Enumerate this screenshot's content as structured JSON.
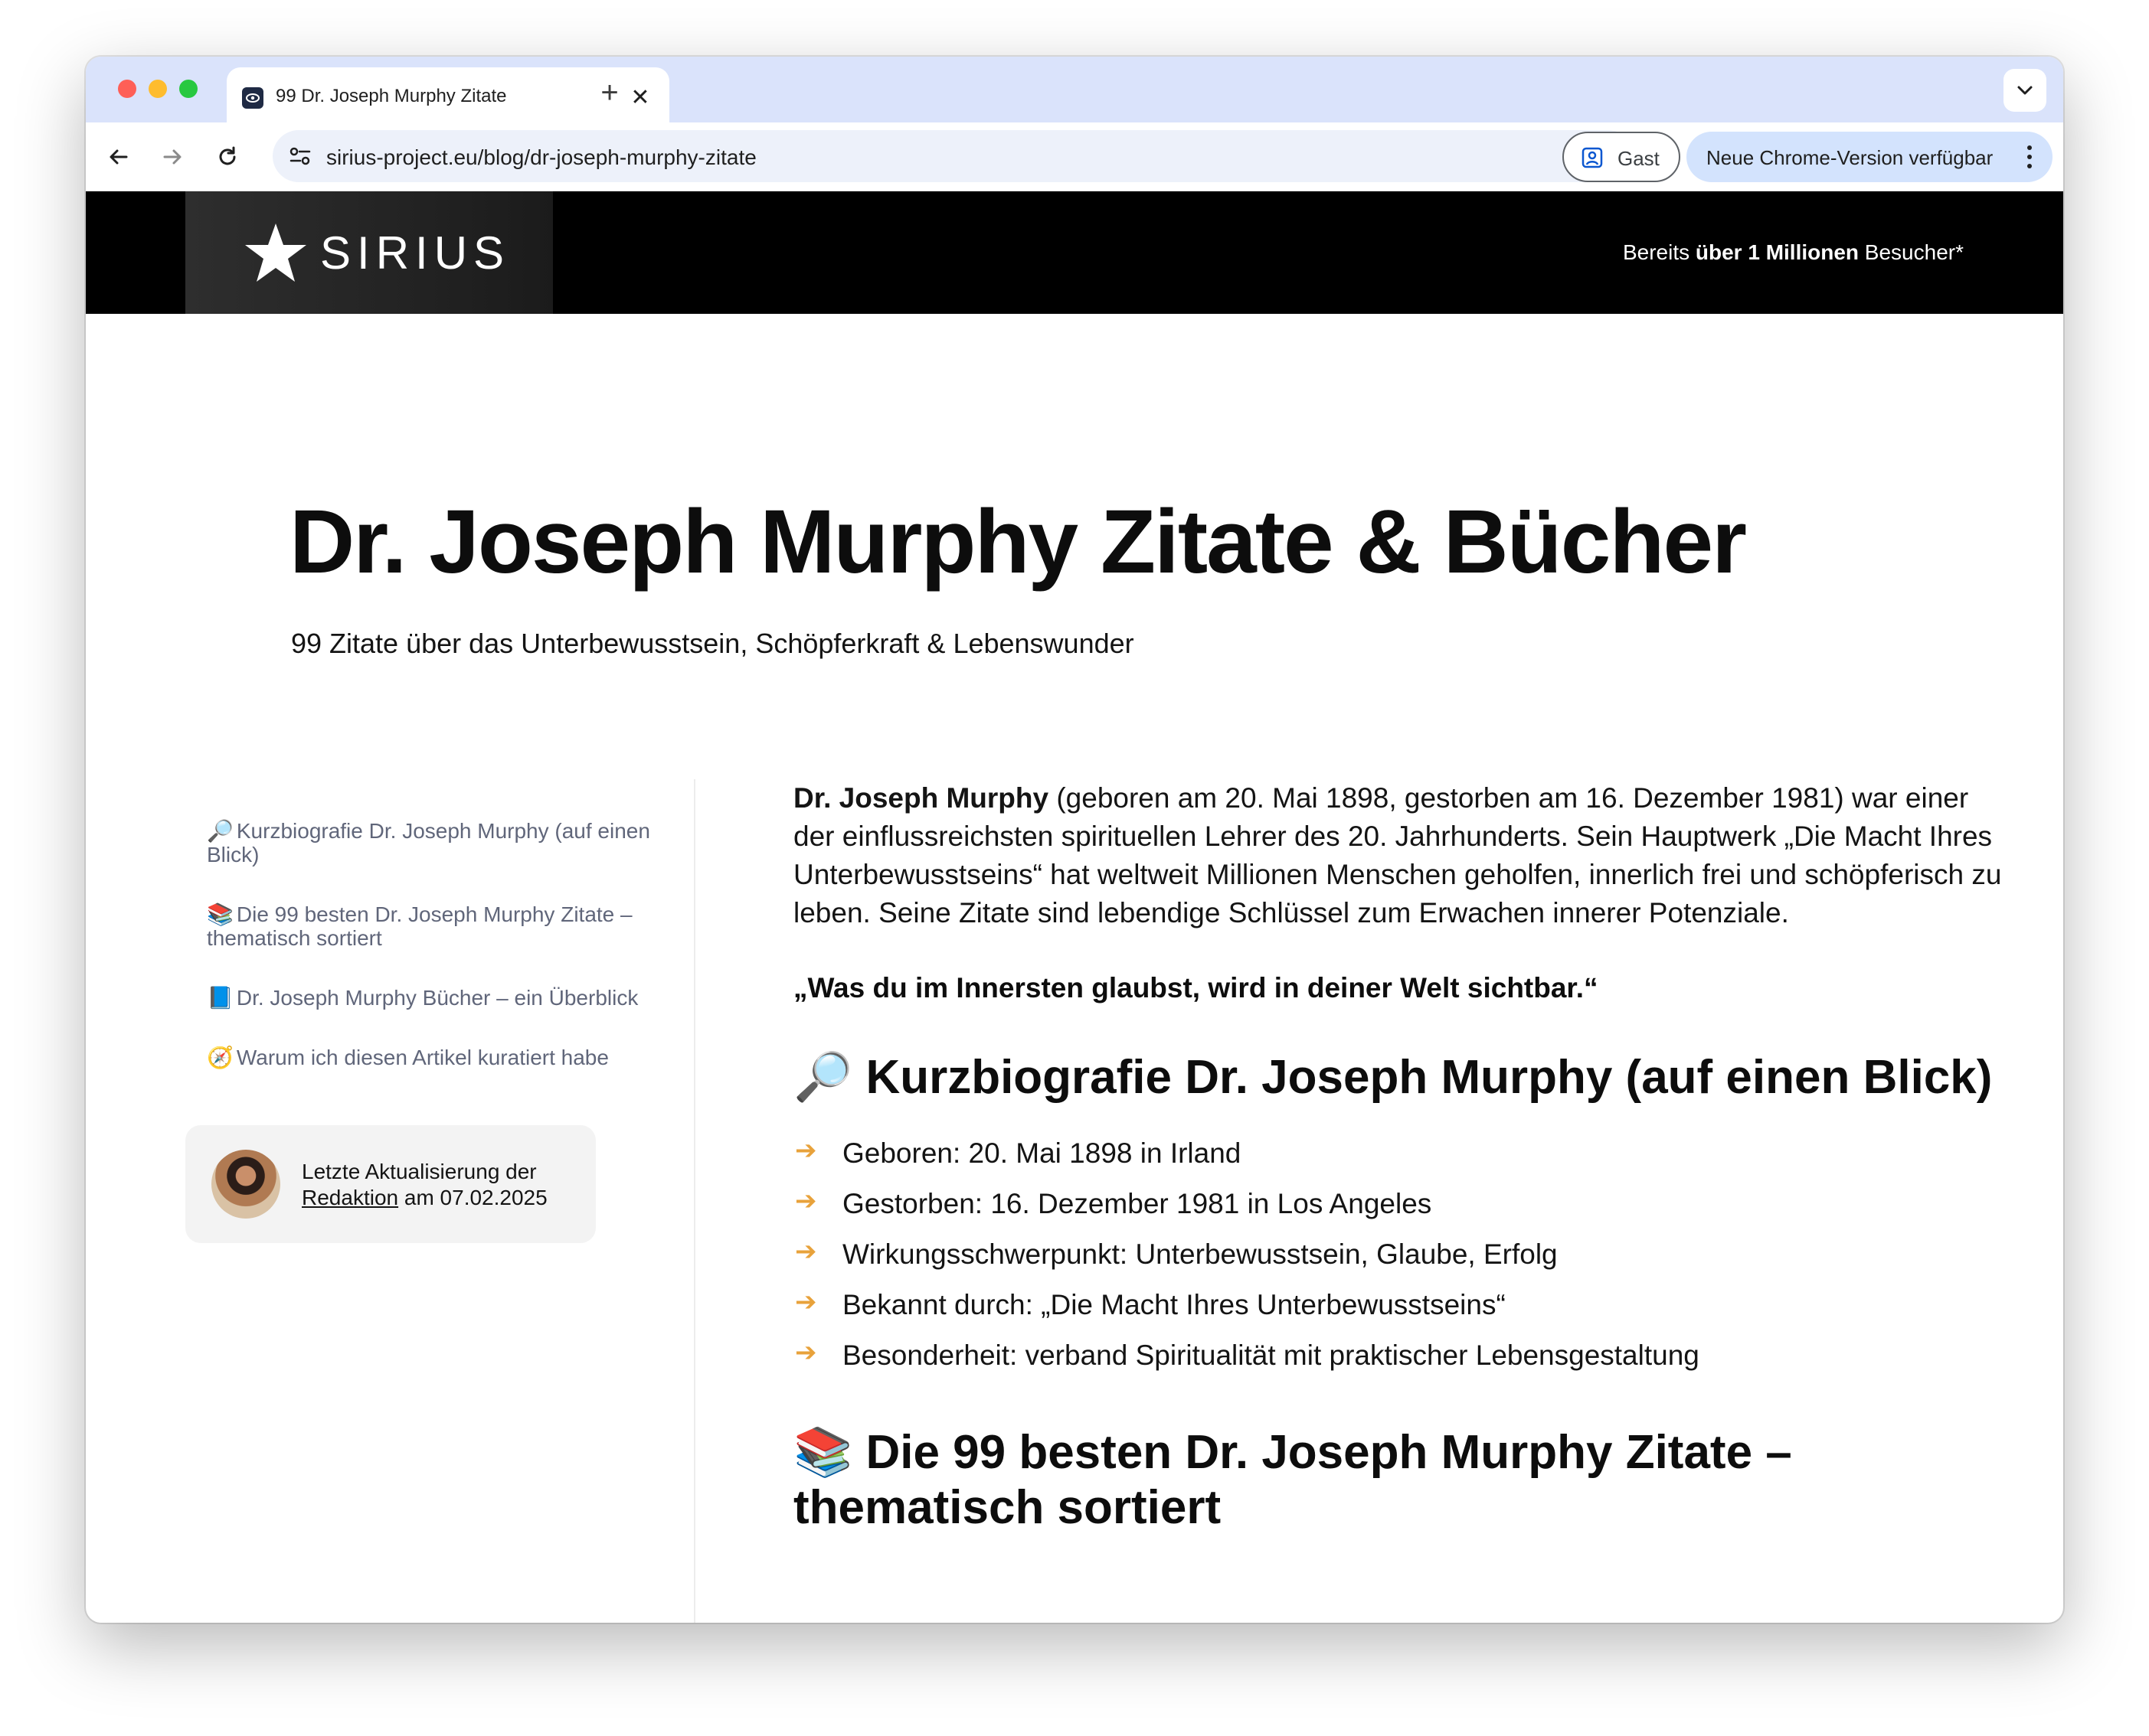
{
  "browser": {
    "tab_title": "99 Dr. Joseph Murphy Zitate",
    "url": "sirius-project.eu/blog/dr-joseph-murphy-zitate",
    "guest_label": "Gast",
    "update_label": "Neue Chrome-Version verfügbar"
  },
  "site": {
    "logo_text": "SIRIUS",
    "visitors_prefix": "Bereits ",
    "visitors_bold": "über 1 Millionen",
    "visitors_suffix": " Besucher*"
  },
  "header": {
    "title": "Dr. Joseph Murphy Zitate & Bücher",
    "subtitle": "99 Zitate über das Unterbewusstsein, Schöpferkraft & Lebenswunder"
  },
  "sidebar": {
    "toc": [
      {
        "emoji": "🔎",
        "label": "Kurzbiografie Dr. Joseph Murphy (auf einen Blick)"
      },
      {
        "emoji": "📚",
        "label": "Die 99 besten Dr. Joseph Murphy Zitate – thematisch sortiert"
      },
      {
        "emoji": "📘",
        "label": "Dr. Joseph Murphy Bücher – ein Überblick"
      },
      {
        "emoji": "🧭",
        "label": "Warum ich diesen Artikel kuratiert habe"
      }
    ],
    "update_card": {
      "line1": "Letzte Aktualisierung der",
      "link": "Redaktion",
      "date_text": " am 07.02.2025"
    }
  },
  "article": {
    "intro_bold": "Dr. Joseph Murphy",
    "intro_rest": " (geboren am 20. Mai 1898, gestorben am 16. Dezember 1981) war einer der einflussreichsten spirituellen Lehrer des 20. Jahrhunderts. Sein Hauptwerk „Die Macht Ihres Unterbewusstseins“ hat weltweit Millionen Menschen geholfen, innerlich frei und schöpferisch zu leben. Seine Zitate sind lebendige Schlüssel zum Erwachen innerer Potenziale.",
    "quote": "„Was du im Innersten glaubst, wird in deiner Welt sichtbar.“",
    "section1_emoji": "🔎",
    "section1_title": "Kurzbiografie Dr. Joseph Murphy (auf einen Blick)",
    "facts": [
      "Geboren: 20. Mai 1898 in Irland",
      "Gestorben: 16. Dezember 1981 in Los Angeles",
      "Wirkungsschwerpunkt: Unterbewusstsein, Glaube, Erfolg",
      "Bekannt durch: „Die Macht Ihres Unterbewusstseins“",
      "Besonderheit: verband Spiritualität mit praktischer Lebensgestaltung"
    ],
    "fact_arrow": "➔",
    "section2_emoji": "📚",
    "section2_title": "Die 99 besten Dr. Joseph Murphy Zitate – thematisch sortiert"
  },
  "icons": {
    "tab_close": "✕",
    "new_tab": "+"
  },
  "colors": {
    "tabstrip": "#dae3fb",
    "update_button": "#d3e3fd",
    "site_header": "#000000",
    "arrow_accent": "#e8a23b",
    "toc_text": "#60667a"
  }
}
